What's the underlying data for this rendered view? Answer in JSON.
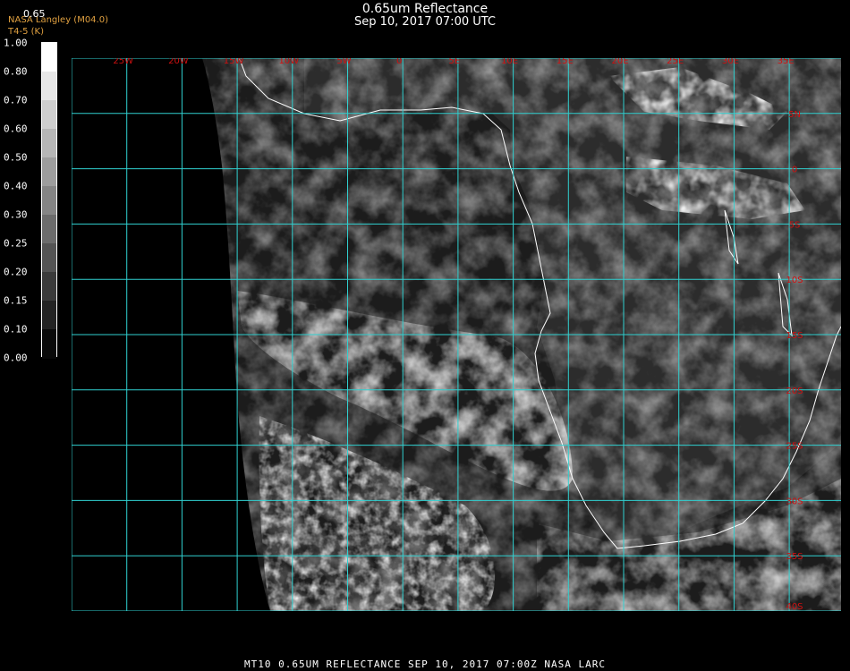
{
  "header": {
    "title": "0.65um Reflectance",
    "datetime": "Sep 10, 2017 07:00 UTC"
  },
  "credit": {
    "line1": "NASA Langley (M04.0)",
    "line2": "T4-5 (K)"
  },
  "colorbar": {
    "label": "0.65",
    "ticks": [
      "1.00",
      "0.80",
      "0.70",
      "0.60",
      "0.50",
      "0.40",
      "0.30",
      "0.25",
      "0.20",
      "0.15",
      "0.10",
      "0.00"
    ]
  },
  "grid": {
    "lon_labels": [
      "25W",
      "20W",
      "15W",
      "10W",
      "5W",
      "0",
      "5E",
      "10E",
      "15E",
      "20E",
      "25E",
      "30E",
      "35E"
    ],
    "lat_labels": [
      "5N",
      "0",
      "5S",
      "10S",
      "15S",
      "20S",
      "25S",
      "30S",
      "35S",
      "40S"
    ],
    "grid_color": "#30d0d0",
    "label_color": "#d01010"
  },
  "footer": {
    "text": "MT10  0.65UM REFLECTANCE   SEP 10, 2017 07:00Z   NASA LARC"
  }
}
